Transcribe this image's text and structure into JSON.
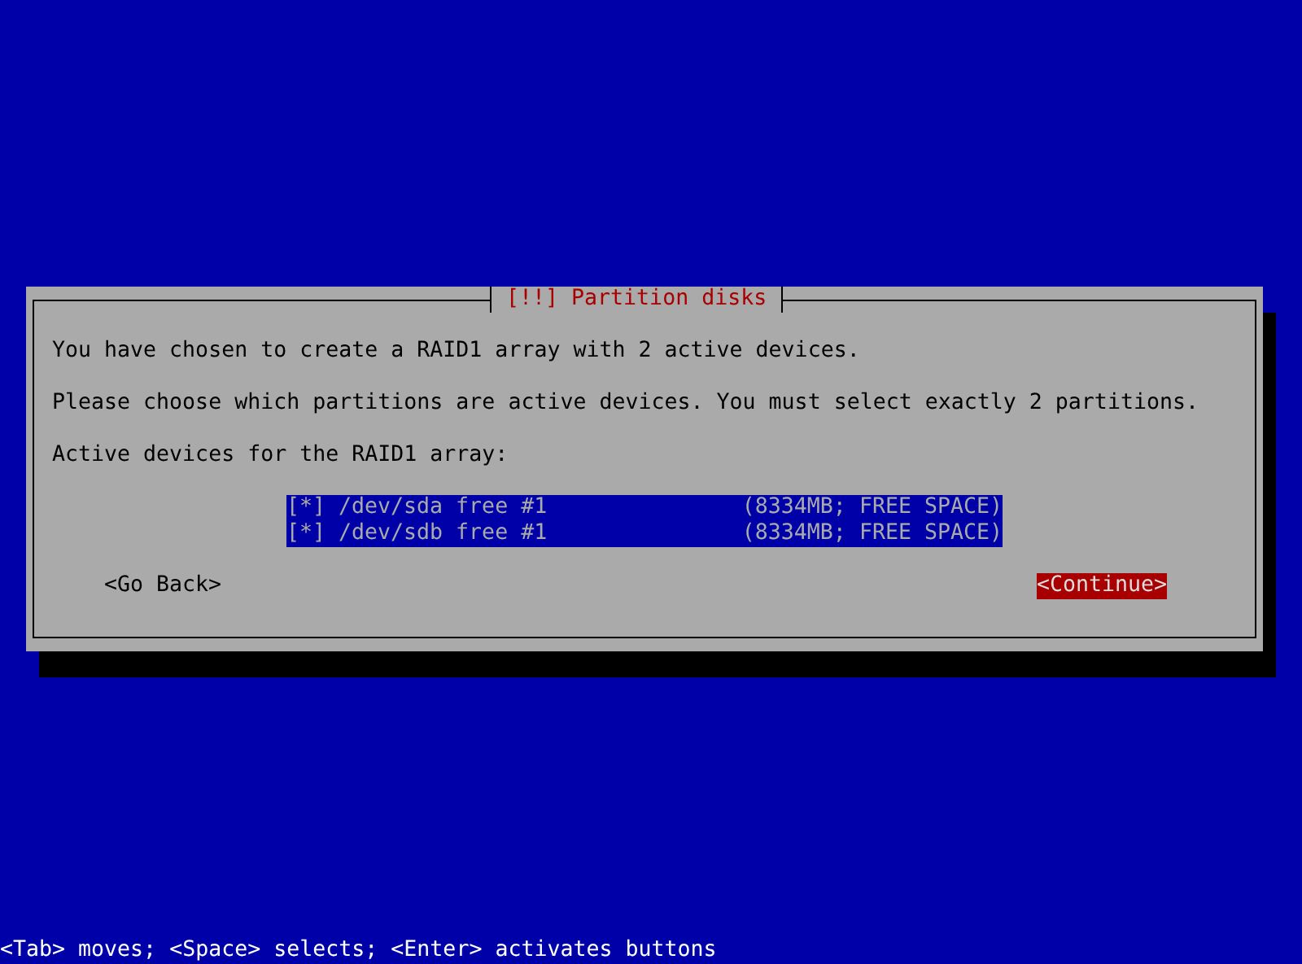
{
  "dialog": {
    "title": "[!!] Partition disks",
    "paragraphs": [
      "You have chosen to create a RAID1 array with 2 active devices.",
      "Please choose which partitions are active devices. You must select exactly 2 partitions.",
      "Active devices for the RAID1 array:"
    ],
    "devices": [
      {
        "box": "[*]",
        "name": "/dev/sda free #1",
        "size": "(8334MB; FREE SPACE)",
        "selected": true
      },
      {
        "box": "[*]",
        "name": "/dev/sdb free #1",
        "size": "(8334MB; FREE SPACE)",
        "selected": true
      }
    ],
    "buttons": [
      {
        "label": "<Go Back>",
        "selected": false
      },
      {
        "label": "<Continue>",
        "selected": true
      }
    ]
  },
  "status_bar": "<Tab> moves; <Space> selects; <Enter> activates buttons"
}
